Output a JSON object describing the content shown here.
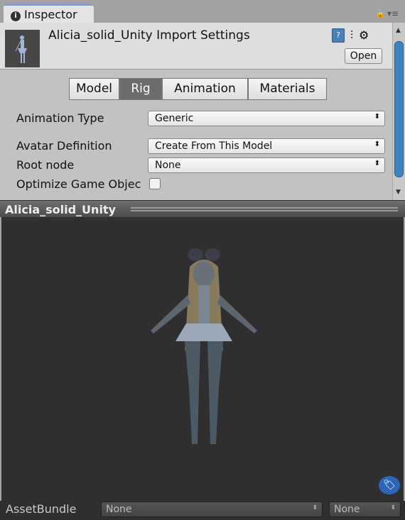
{
  "window": {
    "tab_label": "Inspector",
    "info_icon": "i"
  },
  "header": {
    "title": "Alicia_solid_Unity Import Settings",
    "open_label": "Open",
    "help_icon": "?"
  },
  "tabs": [
    {
      "label": "Model"
    },
    {
      "label": "Rig",
      "selected": true
    },
    {
      "label": "Animation"
    },
    {
      "label": "Materials"
    }
  ],
  "rig": {
    "animation_type": {
      "label": "Animation Type",
      "value": "Generic"
    },
    "avatar_definition": {
      "label": "Avatar Definition",
      "value": "Create From This Model"
    },
    "root_node": {
      "label": "Root node",
      "value": "None"
    },
    "optimize": {
      "label": "Optimize Game Objec",
      "checked": false
    }
  },
  "preview": {
    "title": "Alicia_solid_Unity"
  },
  "footer": {
    "label": "AssetBundle",
    "bundle": "None",
    "variant": "None"
  },
  "colors": {
    "accent": "#3e82c2",
    "selected_tab": "#6c6c6c",
    "preview_bg": "#2f2f2f"
  }
}
